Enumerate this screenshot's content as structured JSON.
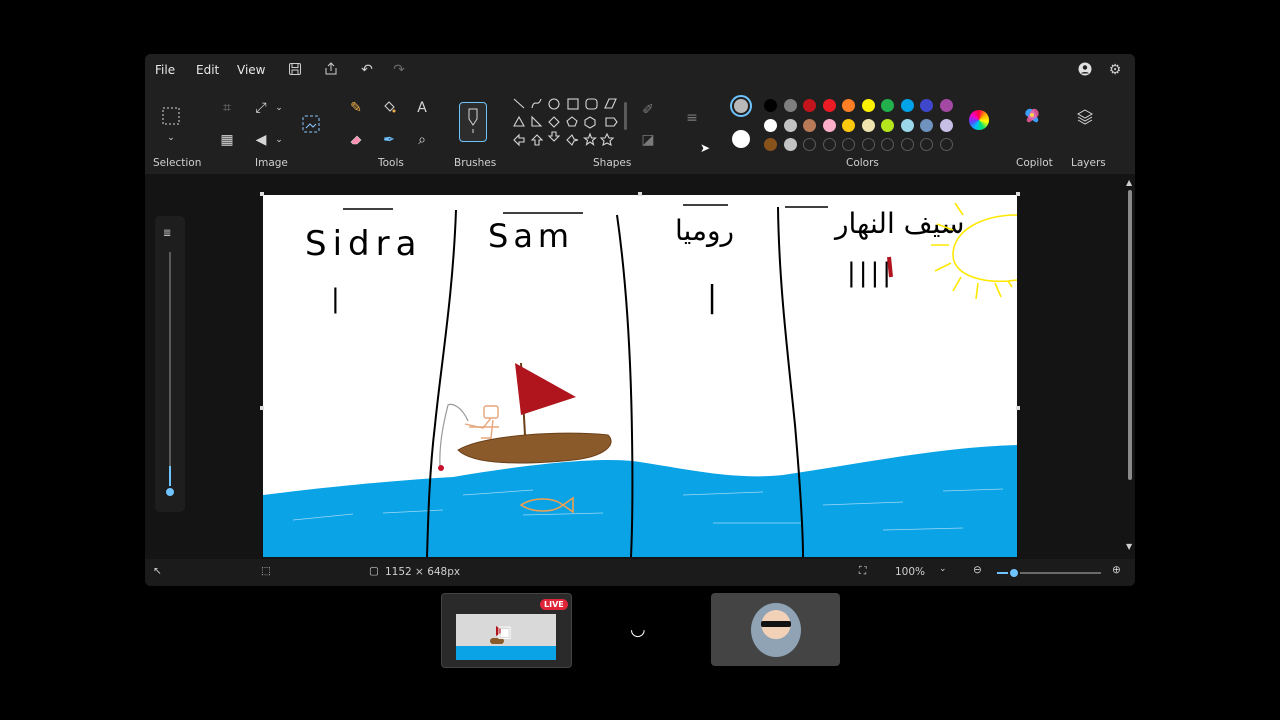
{
  "menu": {
    "file": "File",
    "edit": "Edit",
    "view": "View"
  },
  "ribbon": {
    "selection_label": "Selection",
    "image_label": "Image",
    "tools_label": "Tools",
    "brushes_label": "Brushes",
    "shapes_label": "Shapes",
    "colors_label": "Colors",
    "copilot_label": "Copilot",
    "layers_label": "Layers"
  },
  "colors": {
    "primary": "#b9b9b9",
    "secondary": "#ffffff",
    "row1": [
      "#000000",
      "#7f7f7f",
      "#c3161c",
      "#ec1c24",
      "#ff7f27",
      "#fff200",
      "#22b14c",
      "#00a2e8",
      "#3f48cc",
      "#a349a4"
    ],
    "row2": [
      "#ffffff",
      "#c3c3c3",
      "#b97a57",
      "#ffaec9",
      "#ffc90e",
      "#efe4b0",
      "#b5e61d",
      "#99d9ea",
      "#7092be",
      "#c8bfe7"
    ],
    "row3": [
      "#88531b",
      "#c3c3c3"
    ]
  },
  "canvas": {
    "names": [
      "Sidra",
      "Sam",
      "روميا",
      "سيف النهار"
    ],
    "tally_marks": [
      "|",
      "|",
      "||||"
    ]
  },
  "status": {
    "canvas_size": "1152 × 648px",
    "zoom": "100%"
  },
  "meeting": {
    "live_badge": "LIVE"
  }
}
